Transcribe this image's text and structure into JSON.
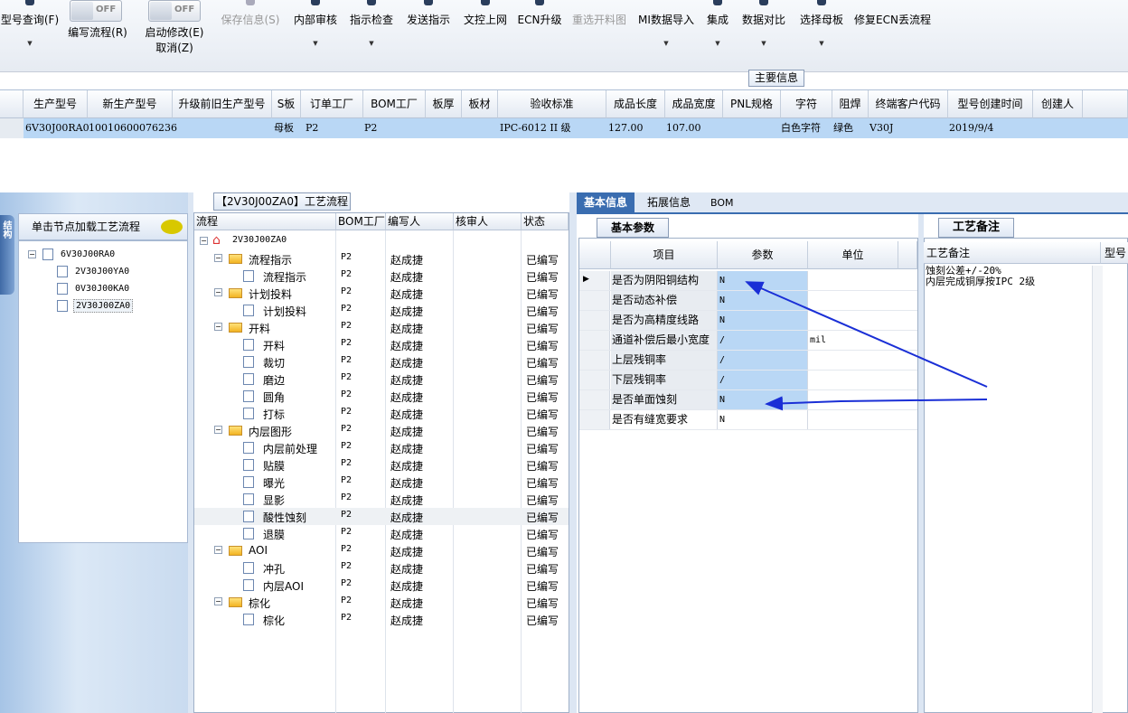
{
  "toolbar": {
    "query_label": "型号查询(F)",
    "write_flow_label": "编写流程(R)",
    "start_modify_label": "启动修改(E)",
    "cancel_label": "取消(Z)",
    "toggle1": "OFF",
    "toggle2": "OFF",
    "save_label": "保存信息(S)",
    "internal_review_label": "内部审核",
    "instruction_check_label": "指示检查",
    "send_instruction_label": "发送指示",
    "doc_upload_label": "文控上网",
    "ecn_upgrade_label": "ECN升级",
    "reselect_label": "重选开料图",
    "mi_import_label": "MI数据导入",
    "integrate_label": "集成",
    "compare_label": "数据对比",
    "select_mother_label": "选择母板",
    "fix_ecn_label": "修复ECN丢流程"
  },
  "main_info_label": "主要信息",
  "grid": {
    "columns": [
      "生产型号",
      "新生产型号",
      "升级前旧生产型号",
      "S板",
      "订单工厂",
      "BOM工厂",
      "板厚",
      "板材",
      "验收标准",
      "成品长度",
      "成品宽度",
      "PNL规格",
      "字符",
      "阻焊",
      "终端客户代码",
      "型号创建时间",
      "创建人"
    ],
    "row": {
      "prod_model": "6V30J00RA0",
      "new_model": "10010600076236",
      "old_model": "",
      "s_board": "母板",
      "order_factory": "P2",
      "bom_factory": "P2",
      "thickness": "",
      "material": "",
      "standard": "IPC-6012 II 级",
      "length": "127.00",
      "width": "107.00",
      "pnl": "",
      "char": "白色字符",
      "mask": "绿色",
      "customer": "V30J",
      "created": "2019/9/4",
      "creator": ""
    }
  },
  "left_panel": {
    "side_tab": "结构",
    "header": "单击节点加载工艺流程",
    "root": "6V30J00RA0",
    "children": [
      "2V30J00YA0",
      "0V30J00KA0",
      "2V30J00ZA0"
    ]
  },
  "flow": {
    "tab_title": "【2V30J00ZA0】工艺流程",
    "headers": [
      "流程",
      "BOM工厂",
      "编写人",
      "核审人",
      "状态"
    ],
    "root": "2V30J00ZA0",
    "rows": [
      {
        "name": "流程指示",
        "bom": "P2",
        "writer": "赵成捷",
        "status": "已编写"
      },
      {
        "name": "流程指示",
        "bom": "P2",
        "writer": "赵成捷",
        "status": "已编写"
      },
      {
        "name": "计划投料",
        "bom": "P2",
        "writer": "赵成捷",
        "status": "已编写"
      },
      {
        "name": "计划投料",
        "bom": "P2",
        "writer": "赵成捷",
        "status": "已编写"
      },
      {
        "name": "开料",
        "bom": "P2",
        "writer": "赵成捷",
        "status": "已编写"
      },
      {
        "name": "开料",
        "bom": "P2",
        "writer": "赵成捷",
        "status": "已编写"
      },
      {
        "name": "裁切",
        "bom": "P2",
        "writer": "赵成捷",
        "status": "已编写"
      },
      {
        "name": "磨边",
        "bom": "P2",
        "writer": "赵成捷",
        "status": "已编写"
      },
      {
        "name": "圆角",
        "bom": "P2",
        "writer": "赵成捷",
        "status": "已编写"
      },
      {
        "name": "打标",
        "bom": "P2",
        "writer": "赵成捷",
        "status": "已编写"
      },
      {
        "name": "内层图形",
        "bom": "P2",
        "writer": "赵成捷",
        "status": "已编写"
      },
      {
        "name": "内层前处理",
        "bom": "P2",
        "writer": "赵成捷",
        "status": "已编写"
      },
      {
        "name": "贴膜",
        "bom": "P2",
        "writer": "赵成捷",
        "status": "已编写"
      },
      {
        "name": "曝光",
        "bom": "P2",
        "writer": "赵成捷",
        "status": "已编写"
      },
      {
        "name": "显影",
        "bom": "P2",
        "writer": "赵成捷",
        "status": "已编写"
      },
      {
        "name": "酸性蚀刻",
        "bom": "P2",
        "writer": "赵成捷",
        "status": "已编写"
      },
      {
        "name": "退膜",
        "bom": "P2",
        "writer": "赵成捷",
        "status": "已编写"
      },
      {
        "name": "AOI",
        "bom": "P2",
        "writer": "赵成捷",
        "status": "已编写"
      },
      {
        "name": "冲孔",
        "bom": "P2",
        "writer": "赵成捷",
        "status": "已编写"
      },
      {
        "name": "内层AOI",
        "bom": "P2",
        "writer": "赵成捷",
        "status": "已编写"
      },
      {
        "name": "棕化",
        "bom": "P2",
        "writer": "赵成捷",
        "status": "已编写"
      },
      {
        "name": "棕化",
        "bom": "P2",
        "writer": "赵成捷",
        "status": "已编写"
      }
    ]
  },
  "info_tabs": [
    "基本信息",
    "拓展信息",
    "BOM"
  ],
  "params": {
    "sub_tab": "基本参数",
    "headers": [
      "项目",
      "参数",
      "单位"
    ],
    "rows": [
      {
        "k": "是否为阴阳铜结构",
        "v": "N",
        "u": ""
      },
      {
        "k": "是否动态补偿",
        "v": "N",
        "u": ""
      },
      {
        "k": "是否为高精度线路",
        "v": "N",
        "u": ""
      },
      {
        "k": "通道补偿后最小宽度",
        "v": "/",
        "u": "mil"
      },
      {
        "k": "上层残铜率",
        "v": "/",
        "u": ""
      },
      {
        "k": "下层残铜率",
        "v": "/",
        "u": ""
      },
      {
        "k": "是否单面蚀刻",
        "v": "N",
        "u": ""
      },
      {
        "k": "是否有缝宽要求",
        "v": "N",
        "u": ""
      }
    ]
  },
  "remark": {
    "tab": "工艺备注",
    "col1": "工艺备注",
    "col2": "型号",
    "text": "蚀刻公差+/-20%\n内层完成铜厚按IPC 2级"
  },
  "colors": {
    "accent": "#3a6db0",
    "selection": "#b9d7f5",
    "arrow": "#1a2fd6"
  }
}
